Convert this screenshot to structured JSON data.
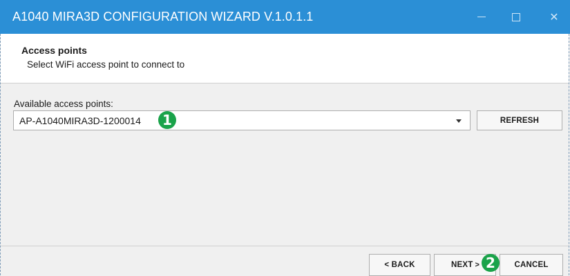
{
  "window": {
    "title": "A1040 MIRA3D CONFIGURATION WIZARD V.1.0.1.1",
    "accent_color": "#2b8fd6",
    "controls": [
      "minimize-icon",
      "maximize-icon",
      "close-icon"
    ],
    "close_glyph": "✕"
  },
  "header": {
    "title": "Access points",
    "subtitle": "Select WiFi access point to connect to"
  },
  "content": {
    "access_points_label": "Available access points:",
    "selected_access_point": "AP-A1040MIRA3D-1200014",
    "refresh_label": "REFRESH"
  },
  "badges": {
    "one": "1",
    "two": "2",
    "color": "#1aa34a"
  },
  "footer": {
    "back_label": "< BACK",
    "next_label": "NEXT",
    "next_arrow": ">",
    "cancel_label": "CANCEL"
  }
}
